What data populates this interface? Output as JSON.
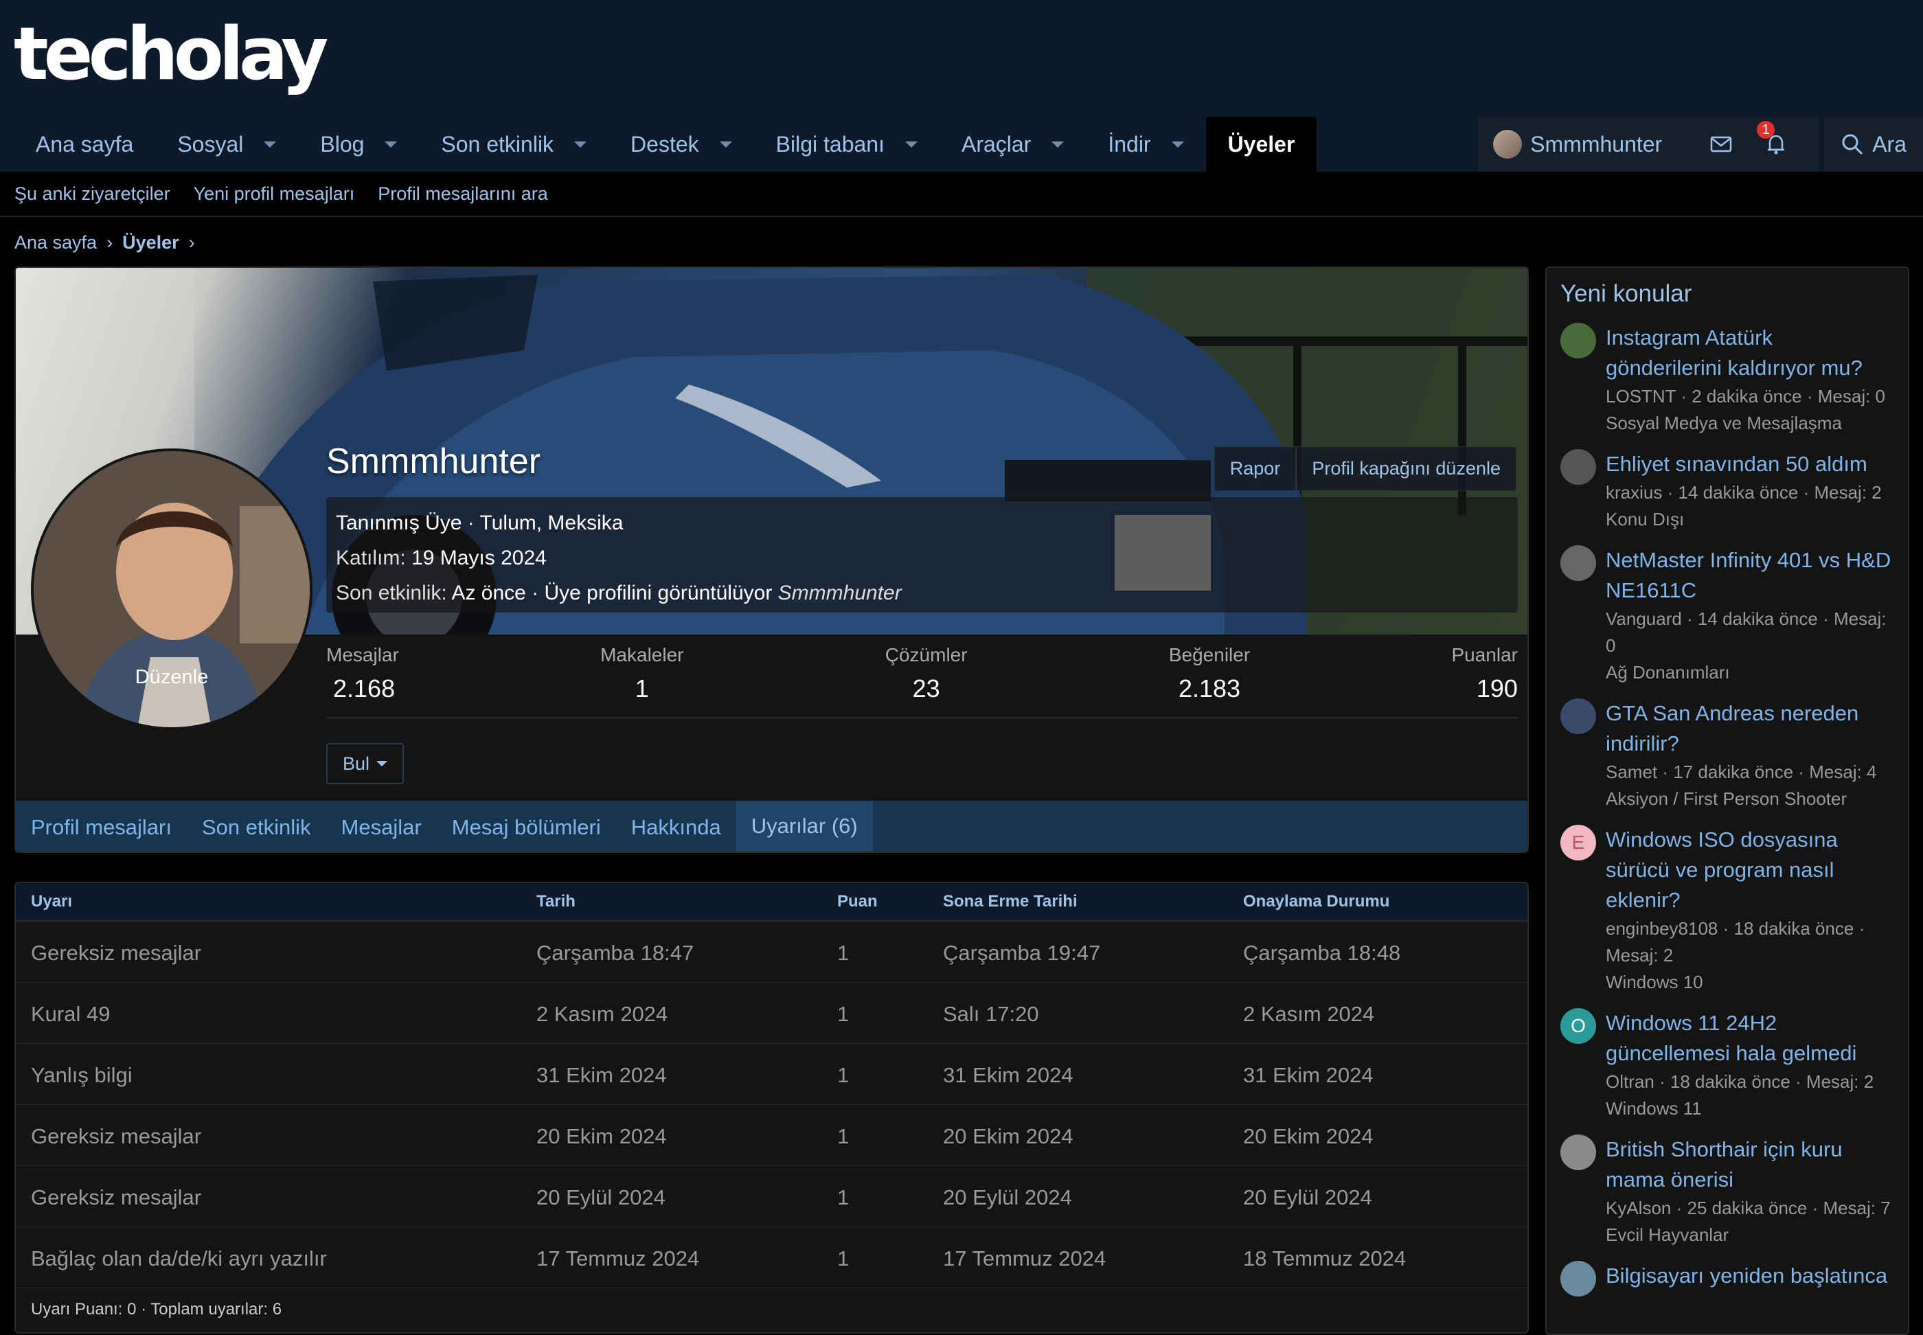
{
  "header": {
    "logo": "techolay",
    "nav": [
      {
        "label": "Ana sayfa",
        "dropdown": false
      },
      {
        "label": "Sosyal",
        "dropdown": true
      },
      {
        "label": "Blog",
        "dropdown": true
      },
      {
        "label": "Son etkinlik",
        "dropdown": true
      },
      {
        "label": "Destek",
        "dropdown": true
      },
      {
        "label": "Bilgi tabanı",
        "dropdown": true
      },
      {
        "label": "Araçlar",
        "dropdown": true
      },
      {
        "label": "İndir",
        "dropdown": true
      },
      {
        "label": "Üyeler",
        "dropdown": false,
        "active": true
      }
    ],
    "user": {
      "name": "Smmmhunter",
      "alerts_count": "1"
    },
    "search_label": "Ara"
  },
  "subnav": [
    "Şu anki ziyaretçiler",
    "Yeni profil mesajları",
    "Profil mesajlarını ara"
  ],
  "breadcrumb": {
    "home": "Ana sayfa",
    "current": "Üyeler"
  },
  "profile": {
    "name": "Smmmhunter",
    "avatar_edit": "Düzenle",
    "buttons": {
      "report": "Rapor",
      "edit_cover": "Profil kapağını düzenle"
    },
    "title_line": "Tanınmış Üye · Tulum, Meksika",
    "joined_label": "Katılım:",
    "joined_value": "19 Mayıs 2024",
    "last_activity_label": "Son etkinlik:",
    "last_activity_value": "Az önce · Üye profilini görüntülüyor",
    "last_activity_user": "Smmmhunter",
    "stats": [
      {
        "label": "Mesajlar",
        "value": "2.168"
      },
      {
        "label": "Makaleler",
        "value": "1"
      },
      {
        "label": "Çözümler",
        "value": "23"
      },
      {
        "label": "Beğeniler",
        "value": "2.183"
      },
      {
        "label": "Puanlar",
        "value": "190"
      }
    ],
    "find_label": "Bul",
    "tabs": [
      "Profil mesajları",
      "Son etkinlik",
      "Mesajlar",
      "Mesaj bölümleri",
      "Hakkında",
      "Uyarılar (6)"
    ],
    "active_tab": "Uyarılar (6)"
  },
  "warnings": {
    "headers": [
      "Uyarı",
      "Tarih",
      "Puan",
      "Sona Erme Tarihi",
      "Onaylama Durumu"
    ],
    "rows": [
      [
        "Gereksiz mesajlar",
        "Çarşamba 18:47",
        "1",
        "Çarşamba 19:47",
        "Çarşamba 18:48"
      ],
      [
        "Kural 49",
        "2 Kasım 2024",
        "1",
        "Salı 17:20",
        "2 Kasım 2024"
      ],
      [
        "Yanlış bilgi",
        "31 Ekim 2024",
        "1",
        "31 Ekim 2024",
        "31 Ekim 2024"
      ],
      [
        "Gereksiz mesajlar",
        "20 Ekim 2024",
        "1",
        "20 Ekim 2024",
        "20 Ekim 2024"
      ],
      [
        "Gereksiz mesajlar",
        "20 Eylül 2024",
        "1",
        "20 Eylül 2024",
        "20 Eylül 2024"
      ],
      [
        "Bağlaç olan da/de/ki ayrı yazılır",
        "17 Temmuz 2024",
        "1",
        "17 Temmuz 2024",
        "18 Temmuz 2024"
      ]
    ],
    "footer": "Uyarı Puanı: 0 · Toplam uyarılar: 6"
  },
  "sidebar": {
    "title": "Yeni konular",
    "threads": [
      {
        "title": "Instagram Atatürk gönderilerini kaldırıyor mu?",
        "meta": "LOSTNT · 2 dakika önce · Mesaj: 0",
        "forum": "Sosyal Medya ve Mesajlaşma",
        "avatar_letter": "",
        "avatar_color": "#4a6a3a"
      },
      {
        "title": "Ehliyet sınavından 50 aldım",
        "meta": "kraxius · 14 dakika önce · Mesaj: 2",
        "forum": "Konu Dışı",
        "avatar_letter": "",
        "avatar_color": "#555555"
      },
      {
        "title": "NetMaster Infinity 401 vs H&D NE1611C",
        "meta": "Vanguard · 14 dakika önce · Mesaj: 0",
        "forum": "Ağ Donanımları",
        "avatar_letter": "",
        "avatar_color": "#666666"
      },
      {
        "title": "GTA San Andreas nereden indirilir?",
        "meta": "Samet · 17 dakika önce · Mesaj: 4",
        "forum": "Aksiyon / First Person Shooter",
        "avatar_letter": "",
        "avatar_color": "#3a4a6a"
      },
      {
        "title": "Windows ISO dosyasına sürücü ve program nasıl eklenir?",
        "meta": "enginbey8108 · 18 dakika önce · Mesaj: 2",
        "forum": "Windows 10",
        "avatar_letter": "E",
        "avatar_color": "#f2b8c0"
      },
      {
        "title": "Windows 11 24H2 güncellemesi hala gelmedi",
        "meta": "Oltran · 18 dakika önce · Mesaj: 2",
        "forum": "Windows 11",
        "avatar_letter": "O",
        "avatar_color": "#2a9a9a"
      },
      {
        "title": "British Shorthair için kuru mama önerisi",
        "meta": "KyAlson · 25 dakika önce · Mesaj: 7",
        "forum": "Evcil Hayvanlar",
        "avatar_letter": "",
        "avatar_color": "#8a8a8a"
      },
      {
        "title": "Bilgisayarı yeniden başlatınca",
        "meta": "",
        "forum": "",
        "avatar_letter": "",
        "avatar_color": "#6a8aa0"
      }
    ]
  }
}
